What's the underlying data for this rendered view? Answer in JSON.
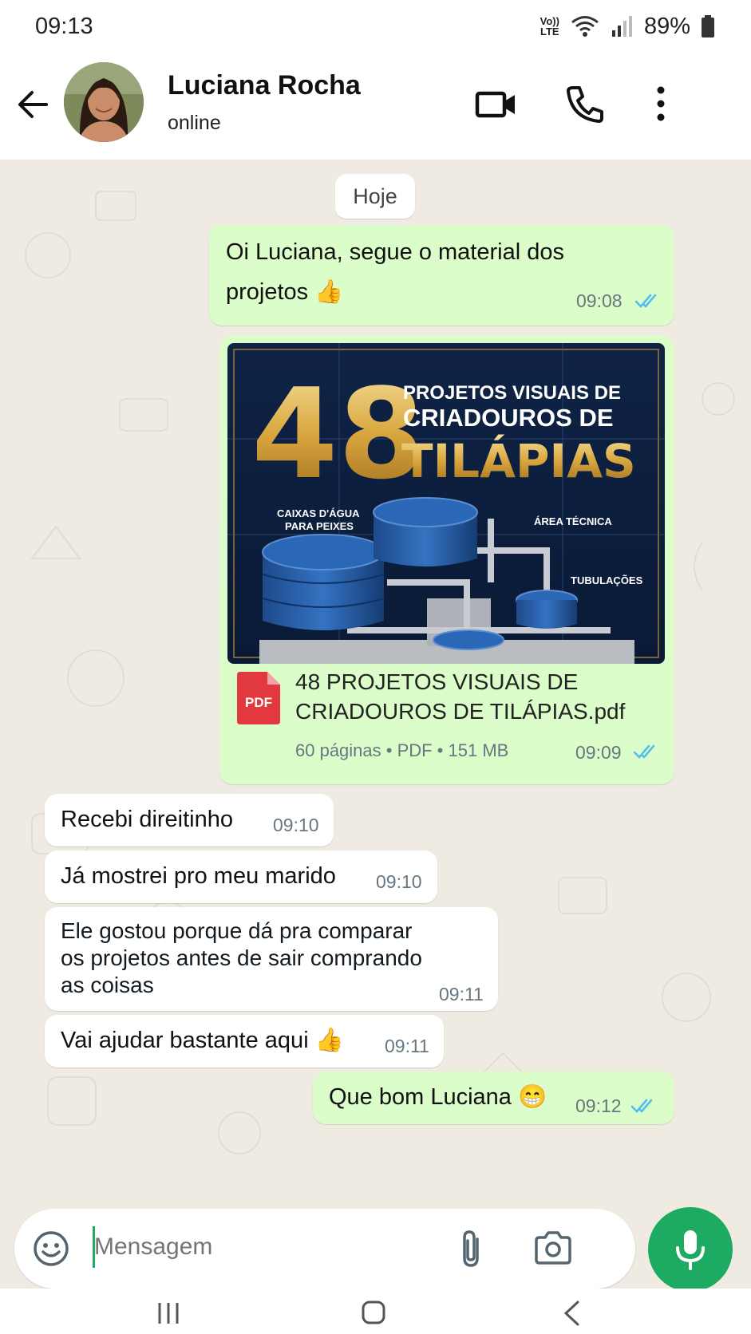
{
  "status_bar": {
    "time": "09:13",
    "network": "LTE",
    "volte": "Vo))",
    "battery": "89%"
  },
  "header": {
    "contact_name": "Luciana Rocha",
    "status": "online",
    "icons": [
      "back-arrow-icon",
      "video-call-icon",
      "phone-icon",
      "more-options-icon"
    ]
  },
  "chat": {
    "date_label": "Hoje",
    "messages": [
      {
        "text": "Oi Luciana, segue o material dos",
        "text2": "projetos 👍",
        "time": "09:08",
        "read": true
      },
      {
        "document": {
          "cover": {
            "number": "48",
            "line1": "PROJETOS VISUAIS DE",
            "line2": "CRIADOUROS DE",
            "line3": "TILÁPIAS",
            "tag1": "CAIXAS D'ÁGUA",
            "tag1b": "PARA PEIXES",
            "tag2": "ÁREA TÉCNICA",
            "tag3": "TUBULAÇÕES"
          },
          "pdf_label": "PDF",
          "name_line1": "48 PROJETOS VISUAIS DE",
          "name_line2": "CRIADOUROS DE TILÁPIAS.pdf",
          "meta": "60 páginas • PDF • 151 MB",
          "time": "09:09"
        }
      },
      {
        "text": "Recebi direitinho",
        "time": "09:10"
      },
      {
        "text": "Já mostrei pro meu marido",
        "time": "09:10"
      },
      {
        "line1": "Ele gostou porque dá pra comparar",
        "line2": "os projetos antes de sair comprando",
        "line3": "as coisas",
        "time": "09:11"
      },
      {
        "text": "Vai ajudar bastante aqui 👍",
        "time": "09:11"
      },
      {
        "text": "Que bom Luciana 😁",
        "time": "09:12",
        "read": true
      }
    ]
  },
  "input": {
    "placeholder": "Mensagem",
    "icons": [
      "emoji-icon",
      "attach-icon",
      "camera-icon",
      "mic-icon"
    ]
  },
  "colors": {
    "outgoing_bubble": "#dafdc9",
    "incoming_bubble": "#ffffff",
    "accent": "#1daa61",
    "read_tick": "#53bdeb",
    "chat_bg": "#efeae2"
  }
}
